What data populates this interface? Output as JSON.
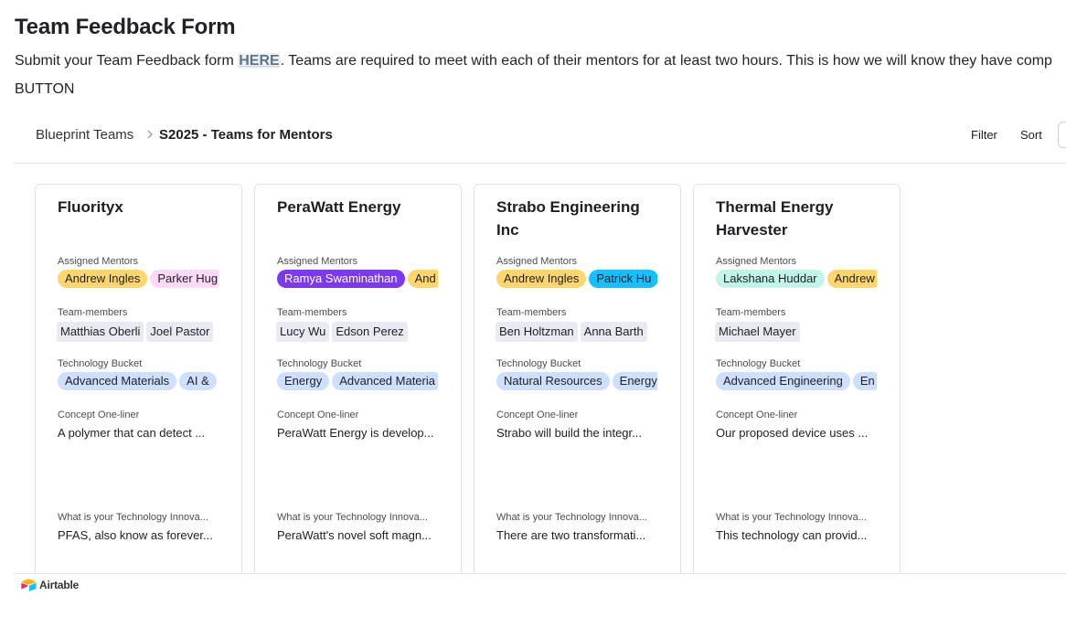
{
  "page": {
    "title": "Team Feedback Form",
    "intro_before": "Submit your Team Feedback form ",
    "intro_link": "HERE",
    "intro_after": ". Teams are required to meet with each of their mentors for at least two hours. This is how we will know they have comp",
    "button_text": "BUTTON"
  },
  "embed": {
    "breadcrumb_base": "Blueprint Teams",
    "breadcrumb_view": "S2025 - Teams for Mentors",
    "filter_label": "Filter",
    "sort_label": "Sort",
    "footer_brand": "Airtable"
  },
  "field_labels": {
    "mentors": "Assigned Mentors",
    "members": "Team-members",
    "bucket": "Technology Bucket",
    "concept": "Concept One-liner",
    "innovation": "What is your Technology Innova..."
  },
  "cards": [
    {
      "title": "Fluorityx",
      "mentors": [
        {
          "name": "Andrew Ingles",
          "color": "#ffd66e",
          "text": "#1d1f25"
        },
        {
          "name": "Parker Hug",
          "color": "#ffdaf6",
          "text": "#1d1f25"
        }
      ],
      "members": [
        "Matthias Oberli",
        "Joel Pastor"
      ],
      "buckets": [
        "Advanced Materials",
        "AI &"
      ],
      "concept": "A polymer that can detect ...",
      "innovation": "PFAS, also know as forever..."
    },
    {
      "title": "PeraWatt Energy",
      "mentors": [
        {
          "name": "Ramya Swaminathan",
          "color": "#7c39ed",
          "text": "#ffffff"
        },
        {
          "name": "And",
          "color": "#ffd66e",
          "text": "#1d1f25"
        }
      ],
      "members": [
        "Lucy Wu",
        "Edson Perez"
      ],
      "buckets": [
        "Energy",
        "Advanced Materia"
      ],
      "concept": "PeraWatt Energy is develop...",
      "innovation": "PeraWatt's novel soft magn..."
    },
    {
      "title": "Strabo Engineering Inc",
      "mentors": [
        {
          "name": "Andrew Ingles",
          "color": "#ffd66e",
          "text": "#1d1f25"
        },
        {
          "name": "Patrick Hu",
          "color": "#18bfff",
          "text": "#1d1f25"
        }
      ],
      "members": [
        "Ben Holtzman",
        "Anna Barth"
      ],
      "buckets": [
        "Natural Resources",
        "Energy"
      ],
      "concept": "Strabo will build the integr...",
      "innovation": "There are two transformati..."
    },
    {
      "title": "Thermal Energy Harvester",
      "mentors": [
        {
          "name": "Lakshana Huddar",
          "color": "#c2f5e9",
          "text": "#1d1f25"
        },
        {
          "name": "Andrew",
          "color": "#ffd66e",
          "text": "#1d1f25"
        }
      ],
      "members": [
        "Michael Mayer"
      ],
      "buckets": [
        "Advanced Engineering",
        "En"
      ],
      "concept": "Our proposed device uses ...",
      "innovation": "This technology can provid..."
    }
  ],
  "colors": {
    "bucket_pill": "#cfdfff",
    "member_chip": "#e9ebf2"
  }
}
